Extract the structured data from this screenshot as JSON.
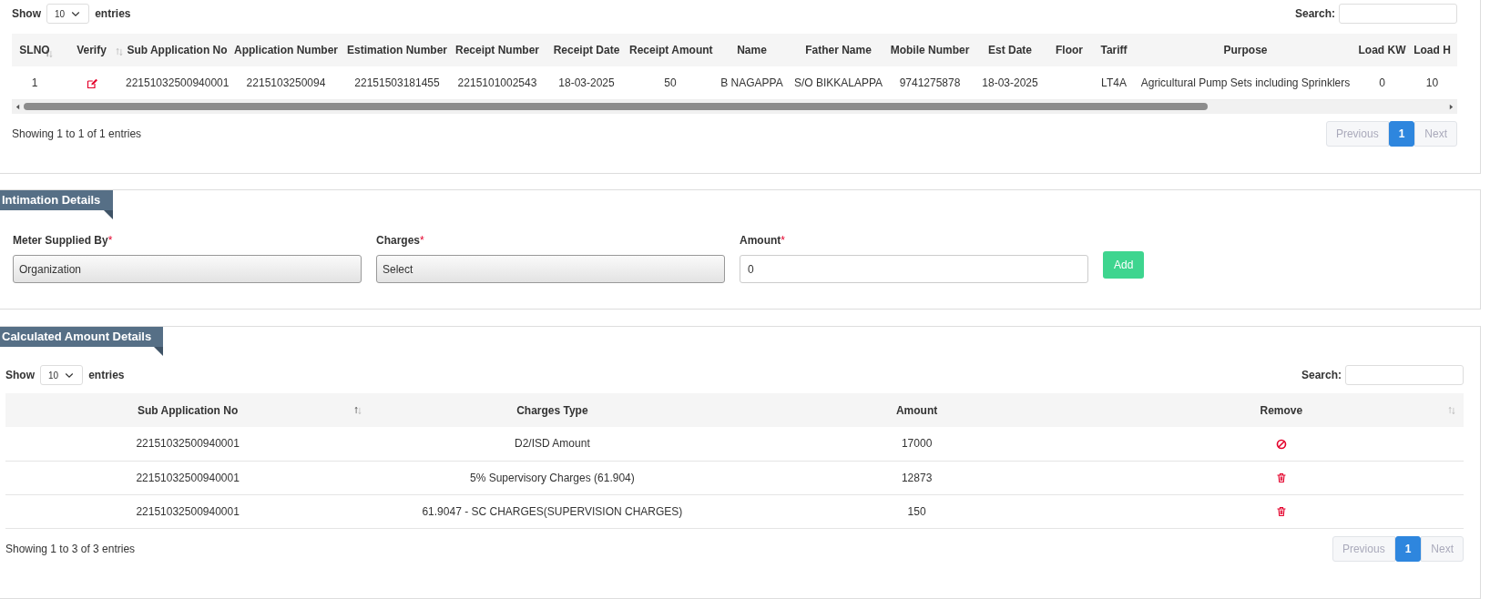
{
  "applications": {
    "length_label_before": "Show",
    "length_value": "10",
    "length_label_after": "entries",
    "search_label": "Search:",
    "columns": [
      "SLNO",
      "Verify",
      "Sub Application No",
      "Application Number",
      "Estimation Number",
      "Receipt Number",
      "Receipt Date",
      "Receipt Amount",
      "Name",
      "Father Name",
      "Mobile Number",
      "Est Date",
      "Floor",
      "Tariff",
      "Purpose",
      "Load KW",
      "Load H"
    ],
    "rows": [
      {
        "cells": [
          "1",
          "",
          "22151032500940001",
          "2215103250094",
          "22151503181455",
          "2215101002543",
          "18-03-2025",
          "50",
          "B NAGAPPA",
          "S/O BIKKALAPPA",
          "9741275878",
          "18-03-2025",
          "",
          "LT4A",
          "Agricultural Pump Sets including Sprinklers",
          "0",
          "10"
        ]
      }
    ],
    "info": "Showing 1 to 1 of 1 entries",
    "pagination": [
      {
        "label": "Previous",
        "selected": false,
        "disabled": true
      },
      {
        "label": "1",
        "selected": true,
        "disabled": false
      },
      {
        "label": "Next",
        "selected": false,
        "disabled": true
      }
    ]
  },
  "intimation": {
    "title": "Intimation Details",
    "fields": [
      {
        "kind": "select",
        "label": "Meter Supplied By",
        "required_mark": "*",
        "value": "Organization"
      },
      {
        "kind": "select",
        "label": "Charges",
        "required_mark": "*",
        "value": "Select"
      },
      {
        "kind": "input",
        "label": "Amount",
        "required_mark": "*",
        "value": "0"
      }
    ],
    "add_button": "Add"
  },
  "calculated": {
    "title": "Calculated Amount Details",
    "length_label_before": "Show",
    "length_value": "10",
    "length_label_after": "entries",
    "search_label": "Search:",
    "columns": [
      "Sub Application No",
      "Charges Type",
      "Amount",
      "Remove"
    ],
    "rows": [
      {
        "cells": [
          "22151032500940001",
          "D2/ISD Amount",
          "17000"
        ],
        "removable": false
      },
      {
        "cells": [
          "22151032500940001",
          "5% Supervisory Charges (61.904)",
          "12873"
        ],
        "removable": true
      },
      {
        "cells": [
          "22151032500940001",
          "61.9047 - SC CHARGES(SUPERVISION CHARGES)",
          "150"
        ],
        "removable": true
      }
    ],
    "info": "Showing 1 to 3 of 3 entries",
    "pagination": [
      {
        "label": "Previous",
        "selected": false,
        "disabled": true
      },
      {
        "label": "1",
        "selected": true,
        "disabled": false
      },
      {
        "label": "Next",
        "selected": false,
        "disabled": true
      }
    ]
  }
}
